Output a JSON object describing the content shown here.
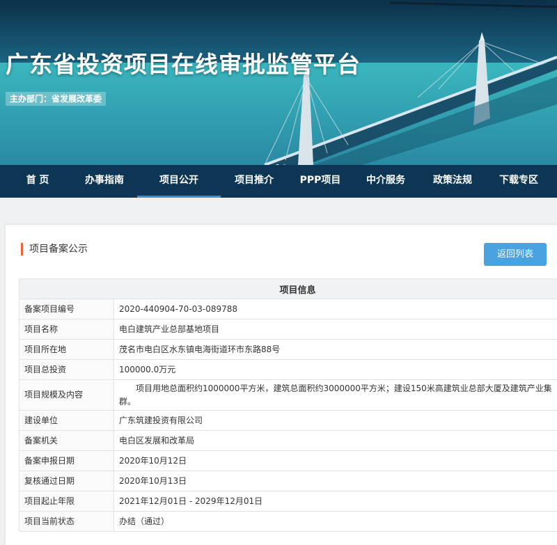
{
  "header": {
    "title": "广东省投资项目在线审批监管平台",
    "sponsor": "主办部门：省发展改革委"
  },
  "nav": {
    "items": [
      {
        "label": "首 页"
      },
      {
        "label": "办事指南"
      },
      {
        "label": "项目公开",
        "active": true
      },
      {
        "label": "项目推介"
      },
      {
        "label": "PPP项目"
      },
      {
        "label": "中介服务"
      },
      {
        "label": "政策法规"
      },
      {
        "label": "下载专区"
      }
    ]
  },
  "section": {
    "title": "项目备案公示",
    "back_button": "返回列表"
  },
  "table": {
    "header": "项目信息",
    "rows": [
      {
        "key": "备案项目编号",
        "value": "2020-440904-70-03-089788"
      },
      {
        "key": "项目名称",
        "value": "电白建筑产业总部基地项目"
      },
      {
        "key": "项目所在地",
        "value": "茂名市电白区水东镇电海街道环市东路88号"
      },
      {
        "key": "项目总投资",
        "value": "100000.0万元"
      },
      {
        "key": "项目规模及内容",
        "value": "项目用地总面积约1000000平方米，建筑总面积约3000000平方米；建设150米高建筑业总部大厦及建筑产业集群。"
      },
      {
        "key": "建设单位",
        "value": "广东筑建投资有限公司"
      },
      {
        "key": "备案机关",
        "value": "电白区发展和改革局"
      },
      {
        "key": "备案申报日期",
        "value": "2020年10月12日"
      },
      {
        "key": "复核通过日期",
        "value": "2020年10月13日"
      },
      {
        "key": "项目起止年限",
        "value": "2021年12月01日 - 2029年12月01日"
      },
      {
        "key": "项目当前状态",
        "value": "办结（通过）"
      }
    ]
  },
  "colors": {
    "nav_bg": "#0d3554",
    "nav_active_underline": "#3d8fd1",
    "accent_bar": "#e8623a",
    "button_bg": "#4aa3de"
  }
}
